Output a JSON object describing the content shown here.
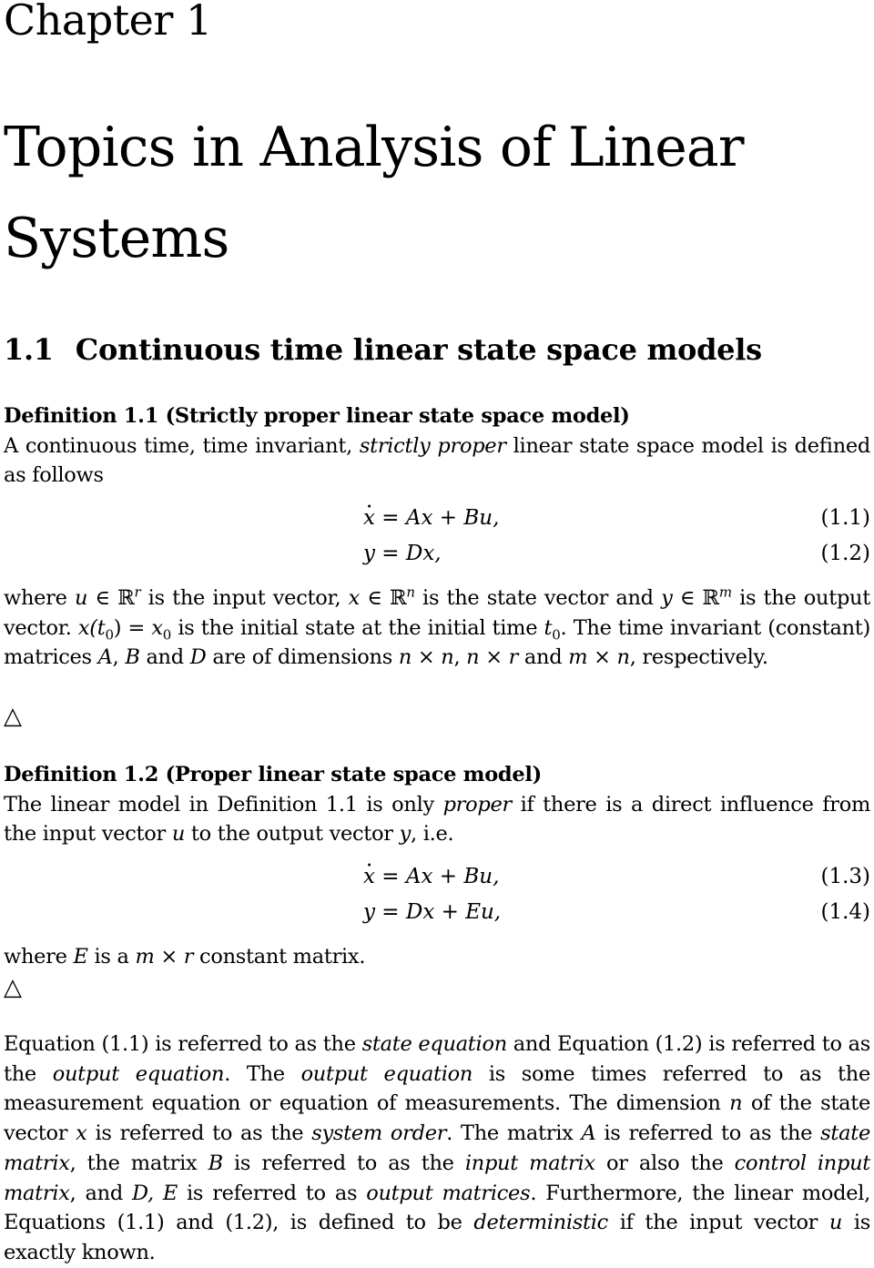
{
  "chapter": {
    "label": "Chapter 1",
    "title": "Topics in Analysis of Linear Systems"
  },
  "section": {
    "number": "1.1",
    "title": "Continuous time linear state space models"
  },
  "definition_1": {
    "heading": "Definition 1.1 (Strictly proper linear state space model)",
    "intro_before": "A continuous time, time invariant, ",
    "intro_emph": "strictly proper",
    "intro_after": " linear state space model is defined as follows",
    "equations": [
      {
        "lhs": "x",
        "lhs_dot": true,
        "rhs": " = Ax + Bu,",
        "tag": "(1.1)"
      },
      {
        "lhs": "y",
        "lhs_dot": false,
        "rhs": " = Dx,",
        "tag": "(1.2)"
      }
    ],
    "where_text": {
      "p1": "where ",
      "u": "u",
      "in": " ∈ ℝ",
      "r": "r",
      "p2": " is the input vector, ",
      "x": "x",
      "n": "n",
      "p3": " is the state vector and ",
      "y": "y",
      "m": "m",
      "p4": " is the output vector. ",
      "xt0": "x(t",
      "zero": "0",
      "eq": ") = ",
      "x0": "x",
      "p5": " is the initial state at the initial time ",
      "t0": "t",
      "p6": ". The time invariant (constant) matrices ",
      "A": "A",
      "comma": ", ",
      "B": "B",
      "and": " and ",
      "D": "D",
      "p7": " are of dimensions ",
      "nxn": "n × n",
      "nxr": "n × r",
      "mxn": "m × n",
      "p8": ", respectively."
    },
    "end_marker": "△"
  },
  "definition_2": {
    "heading": "Definition 1.2 (Proper linear state space model)",
    "intro_before": "The linear model in Definition 1.1 is only ",
    "intro_emph": "proper",
    "intro_mid": " if there is a direct influence from the input vector ",
    "u": "u",
    "intro_mid2": " to the output vector ",
    "y": "y",
    "intro_after": ", i.e.",
    "equations": [
      {
        "lhs": "x",
        "lhs_dot": true,
        "rhs": " = Ax + Bu,",
        "tag": "(1.3)"
      },
      {
        "lhs": "y",
        "lhs_dot": false,
        "rhs": " = Dx + Eu,",
        "tag": "(1.4)"
      }
    ],
    "where_before": "where ",
    "where_E": "E",
    "where_mid": " is a ",
    "where_dims": "m × r",
    "where_after": " constant matrix.",
    "end_marker": "△"
  },
  "closing_paragraph": {
    "s1": "Equation (1.1) is referred to as the ",
    "e1": "state equation",
    "s2": " and Equation (1.2) is referred to as the ",
    "e2": "output equation",
    "s3": ". The ",
    "e3": "output equation",
    "s4": " is some times referred to as the measurement equation or equation of measurements. The dimension ",
    "n": "n",
    "s5": " of the state vector ",
    "x": "x",
    "s6": " is referred to as the ",
    "e4": "system order",
    "s7": ". The matrix ",
    "A": "A",
    "s8": " is referred to as the ",
    "e5": "state matrix",
    "s9": ", the matrix ",
    "B": "B",
    "s10": " is referred to as the ",
    "e6": "input matrix",
    "s11": " or also the ",
    "e7": "control input matrix",
    "s12": ", and ",
    "DE": "D, E",
    "s13": " is referred to as ",
    "e8": "output matrices",
    "s14": ". Furthermore, the linear model, Equations (1.1) and (1.2), is defined to be ",
    "e9": "deterministic",
    "s15": " if the input vector ",
    "u": "u",
    "s16": " is exactly known."
  }
}
